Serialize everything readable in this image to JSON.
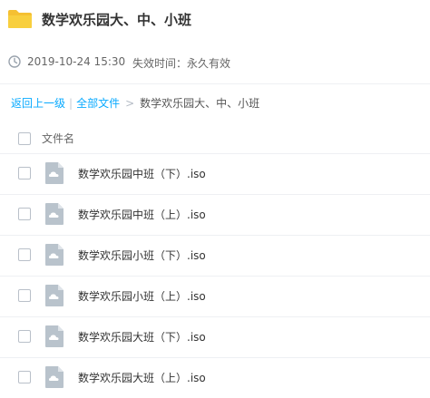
{
  "header": {
    "title": "数学欢乐园大、中、小班",
    "icon": "folder-icon",
    "folder_color": "#f8cf3e"
  },
  "meta": {
    "datetime": "2019-10-24 15:30",
    "expire_label": "失效时间：永久有效"
  },
  "breadcrumb": {
    "back": "返回上一级",
    "separator": "|",
    "all_files": "全部文件",
    "arrow": ">",
    "current": "数学欢乐园大、中、小班"
  },
  "list": {
    "column_header": "文件名",
    "files": [
      {
        "name": "数学欢乐园中班（下）.iso"
      },
      {
        "name": "数学欢乐园中班（上）.iso"
      },
      {
        "name": "数学欢乐园小班（下）.iso"
      },
      {
        "name": "数学欢乐园小班（上）.iso"
      },
      {
        "name": "数学欢乐园大班（下）.iso"
      },
      {
        "name": "数学欢乐园大班（上）.iso"
      }
    ]
  },
  "colors": {
    "link": "#09aaff",
    "file_icon": "#b9c3cc"
  }
}
